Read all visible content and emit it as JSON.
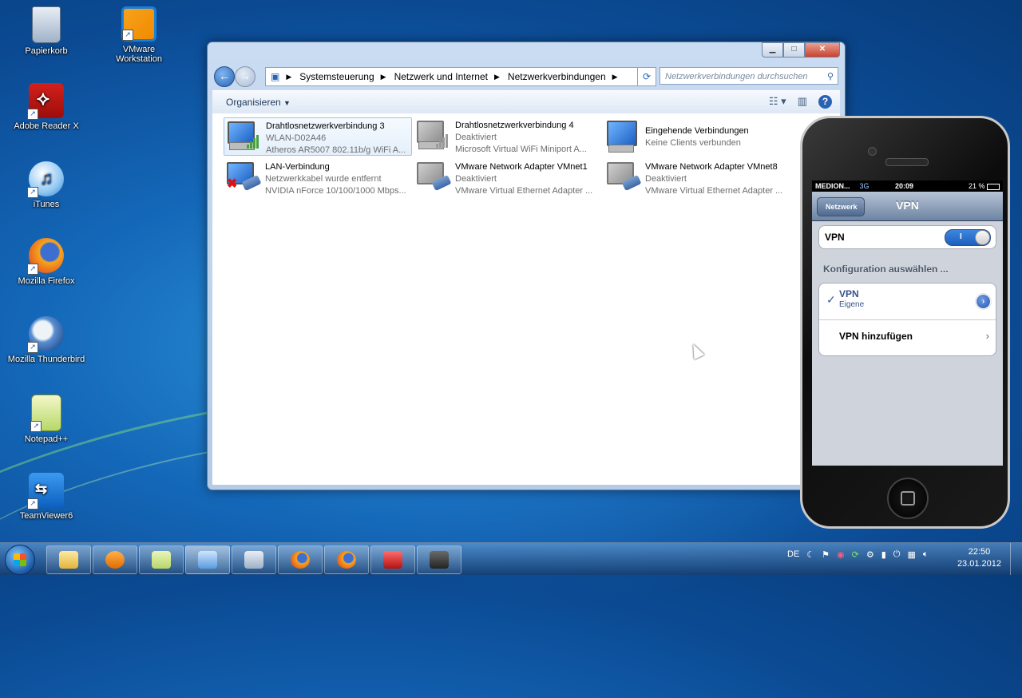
{
  "desktop": {
    "icons": [
      {
        "label": "Papierkorb",
        "icon": "recycle-bin-icon"
      },
      {
        "label": "VMware Workstation",
        "icon": "vmware-icon"
      },
      {
        "label": "Adobe Reader X",
        "icon": "adobe-reader-icon"
      },
      {
        "label": "iTunes",
        "icon": "itunes-icon"
      },
      {
        "label": "Mozilla Firefox",
        "icon": "firefox-icon"
      },
      {
        "label": "Mozilla Thunderbird",
        "icon": "thunderbird-icon"
      },
      {
        "label": "Notepad++",
        "icon": "notepadpp-icon"
      },
      {
        "label": "TeamViewer6",
        "icon": "teamviewer-icon"
      }
    ]
  },
  "explorer": {
    "breadcrumb": [
      "Systemsteuerung",
      "Netzwerk und Internet",
      "Netzwerkverbindungen"
    ],
    "search_placeholder": "Netzwerkverbindungen durchsuchen",
    "organize_label": "Organisieren",
    "connections": [
      {
        "name": "Drahtlosnetzwerkverbindung 3",
        "status": "WLAN-D02A46",
        "device": "Atheros AR5007 802.11b/g WiFi A...",
        "type": "wifi",
        "selected": true
      },
      {
        "name": "Drahtlosnetzwerkverbindung 4",
        "status": "Deaktiviert",
        "device": "Microsoft Virtual WiFi Miniport A...",
        "type": "wifi-disabled",
        "selected": false
      },
      {
        "name": "Eingehende Verbindungen",
        "status": "Keine Clients verbunden",
        "device": "",
        "type": "incoming",
        "selected": false
      },
      {
        "name": "LAN-Verbindung",
        "status": "Netzwerkkabel wurde entfernt",
        "device": "NVIDIA nForce 10/100/1000 Mbps...",
        "type": "lan-unplugged",
        "selected": false
      },
      {
        "name": "VMware Network Adapter VMnet1",
        "status": "Deaktiviert",
        "device": "VMware Virtual Ethernet Adapter ...",
        "type": "lan-disabled",
        "selected": false
      },
      {
        "name": "VMware Network Adapter VMnet8",
        "status": "Deaktiviert",
        "device": "VMware Virtual Ethernet Adapter ...",
        "type": "lan-disabled",
        "selected": false
      }
    ]
  },
  "phone": {
    "carrier": "MEDION...",
    "network": "3G",
    "time": "20:09",
    "battery": "21 %",
    "back_label": "Netzwerk",
    "title": "VPN",
    "vpn_label": "VPN",
    "vpn_toggle": "I",
    "vpn_on": true,
    "section_header": "Konfiguration auswählen ...",
    "config_name": "VPN",
    "config_sub": "Eigene",
    "add_label": "VPN hinzufügen"
  },
  "taskbar": {
    "language": "DE",
    "time": "22:50",
    "date": "23.01.2012",
    "buttons": [
      "explorer",
      "media-player",
      "notes",
      "control-panel",
      "window",
      "firefox",
      "firefox-2",
      "toolbox",
      "camera"
    ]
  }
}
